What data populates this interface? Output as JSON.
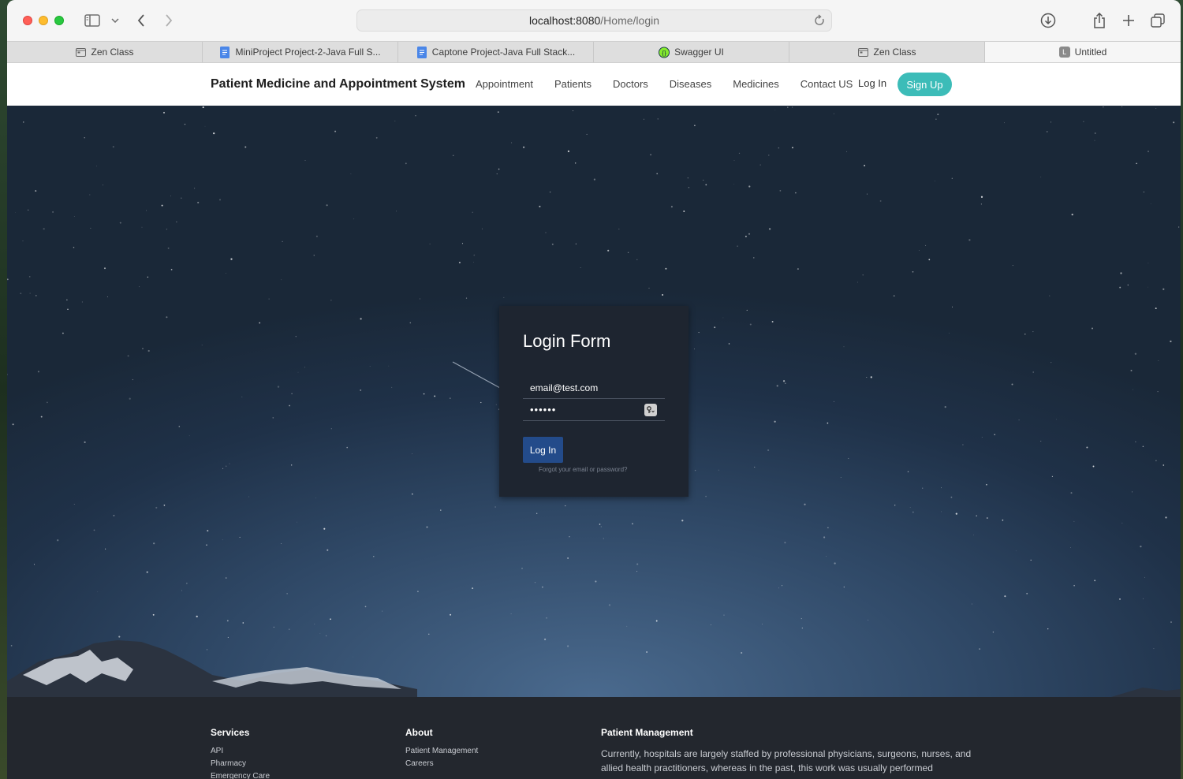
{
  "browser": {
    "url_host": "localhost:8080",
    "url_path": "/Home/login",
    "tabs": [
      {
        "label": "Zen Class",
        "icon": "page-icon"
      },
      {
        "label": "MiniProject Project-2-Java Full S...",
        "icon": "docs-icon"
      },
      {
        "label": "Captone Project-Java Full Stack...",
        "icon": "docs-icon"
      },
      {
        "label": "Swagger UI",
        "icon": "swagger-icon"
      },
      {
        "label": "Zen Class",
        "icon": "page-icon"
      },
      {
        "label": "Untitled",
        "icon": "letter-l-icon",
        "avatar_letter": "L"
      }
    ]
  },
  "navbar": {
    "brand": "Patient Medicine and Appointment System",
    "links": [
      "Appointment",
      "Patients",
      "Doctors",
      "Diseases",
      "Medicines",
      "Contact US"
    ],
    "login": "Log In",
    "signup": "Sign Up"
  },
  "login": {
    "title": "Login Form",
    "email_value": "email@test.com",
    "password_value": "••••••",
    "button": "Log In",
    "forgot": "Forgot your email or password?"
  },
  "footer": {
    "services": {
      "heading": "Services",
      "items": [
        "API",
        "Pharmacy",
        "Emergency Care"
      ]
    },
    "about": {
      "heading": "About",
      "items": [
        "Patient Management",
        "Careers"
      ]
    },
    "patient_mgmt": {
      "heading": "Patient Management",
      "text": "Currently, hospitals are largely staffed by professional physicians, surgeons, nurses, and allied health practitioners, whereas in the past, this work was usually performed"
    }
  },
  "colors": {
    "accent": "#3cbcb8",
    "login_button": "#234b8a",
    "card": "#1e2530",
    "footer": "#23272e"
  }
}
